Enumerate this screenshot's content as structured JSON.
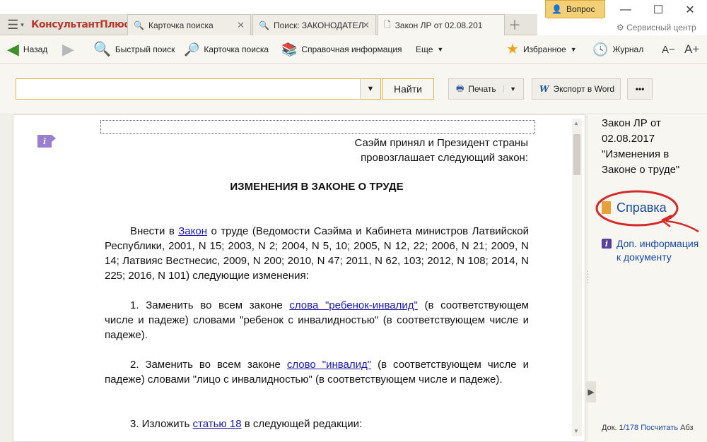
{
  "tabs": [
    {
      "label": "Карточка поиска"
    },
    {
      "label": "Поиск: ЗАКОНОДАТЕЛ"
    },
    {
      "label": "Закон ЛР от 02.08.201"
    }
  ],
  "logo": "КонсультантПлюс",
  "question_label": "Вопрос",
  "service_label": "Сервисный центр",
  "toolbar": {
    "back": "Назад",
    "quick_search": "Быстрый поиск",
    "search_card": "Карточка поиска",
    "reference_info": "Справочная информация",
    "more": "Еще",
    "favorites": "Избранное",
    "journal": "Журнал",
    "font_decrease": "A−",
    "font_increase": "A+"
  },
  "search": {
    "value": "",
    "placeholder": "",
    "find_label": "Найти"
  },
  "actions": {
    "print": "Печать",
    "export_word": "Экспорт в Word",
    "more": "•••"
  },
  "document": {
    "preamble_line1": "Саэйм принял и Президент страны",
    "preamble_line2": "провозглашает следующий закон:",
    "heading": "ИЗМЕНЕНИЯ В ЗАКОНЕ О ТРУДЕ",
    "intro_pre": "Внести в ",
    "intro_link": "Закон",
    "intro_post": " о труде (Ведомости Саэйма и Кабинета министров Латвийской Республики, 2001, N 15; 2003, N 2; 2004, N 5, 10; 2005, N 12, 22; 2006, N 21; 2009, N 14; Латвияс Вестнесис, 2009, N 200; 2010, N 47; 2011, N 62, 103; 2012, N 108; 2014, N 225; 2016, N 101) следующие изменения:",
    "item1_pre": "1. Заменить во всем законе ",
    "item1_link": "слова \"ребенок-инвалид\"",
    "item1_post": " (в соответствующем числе и падеже) словами \"ребенок с инвалидностью\" (в соответствующем числе и падеже).",
    "item2_pre": "2. Заменить во всем законе ",
    "item2_link": "слово \"инвалид\"",
    "item2_post": " (в соответствующем числе и падеже) словами \"лицо с инвалидностью\" (в соответствующем числе и падеже).",
    "item3_pre": "3. Изложить ",
    "item3_link": "статью 18",
    "item3_post": " в следующей редакции:"
  },
  "right_panel": {
    "title": "Закон ЛР от 02.08.2017 \"Изменения в Законе о труде\"",
    "spravka": "Справка",
    "dop_info": "Доп. информация к документу"
  },
  "footer": {
    "doc_label": "Док. 1",
    "total": "/178",
    "count_link": "Посчитать",
    "trailing": "Абз"
  },
  "colors": {
    "accent": "#17479e",
    "annotation": "#d42a2a",
    "question_bg": "#f4cf75"
  }
}
